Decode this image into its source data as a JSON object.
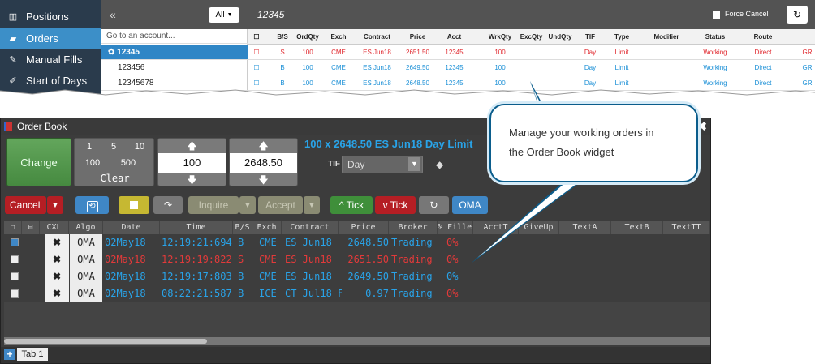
{
  "nav": {
    "items": [
      {
        "label": "Positions",
        "icon": "chart-icon"
      },
      {
        "label": "Orders",
        "icon": "book-icon"
      },
      {
        "label": "Manual Fills",
        "icon": "hammer-icon"
      },
      {
        "label": "Start of Days",
        "icon": "pin-icon"
      }
    ]
  },
  "account_panel": {
    "collapse_glyph": "«",
    "all_label": "All",
    "search_placeholder": "Go to an account...",
    "accounts": [
      "12345",
      "123456",
      "12345678"
    ]
  },
  "grid": {
    "title": "12345",
    "force_cancel_label": "Force Cancel",
    "columns": [
      "B/S",
      "OrdQty",
      "Exch",
      "Contract",
      "Price",
      "Acct",
      "WrkQty",
      "ExcQty",
      "UndQty",
      "TIF",
      "Type",
      "Modifier",
      "Status",
      "Route"
    ],
    "rows": [
      {
        "bs": "S",
        "ordqty": "100",
        "exch": "CME",
        "contract": "ES Jun18",
        "price": "2651.50",
        "acct": "12345",
        "wrkqty": "100",
        "tif": "Day",
        "type": "Limit",
        "status": "Working",
        "route": "Direct",
        "extra": "GR",
        "color": "red"
      },
      {
        "bs": "B",
        "ordqty": "100",
        "exch": "CME",
        "contract": "ES Jun18",
        "price": "2649.50",
        "acct": "12345",
        "wrkqty": "100",
        "tif": "Day",
        "type": "Limit",
        "status": "Working",
        "route": "Direct",
        "extra": "GR",
        "color": "blue"
      },
      {
        "bs": "B",
        "ordqty": "100",
        "exch": "CME",
        "contract": "ES Jun18",
        "price": "2648.50",
        "acct": "12345",
        "wrkqty": "100",
        "tif": "Day",
        "type": "Limit",
        "status": "Working",
        "route": "Direct",
        "extra": "GR",
        "color": "blue"
      }
    ]
  },
  "callout": {
    "line1": "Manage your working orders in",
    "line2": "the Order Book widget"
  },
  "order_book": {
    "title": "Order Book",
    "change_label": "Change",
    "qty_keys": [
      "1",
      "5",
      "10",
      "100",
      "500"
    ],
    "clear_label": "Clear",
    "quantity_value": "100",
    "price_value": "2648.50",
    "order_summary": "100 x 2648.50 ES Jun18 Day Limit",
    "tif_label": "TIF",
    "tif_value": "Day",
    "buttons": {
      "cancel": "Cancel",
      "inquire": "Inquire",
      "accept": "Accept",
      "buy_tick": "Tick",
      "sell_tick": "Tick",
      "oma": "OMA"
    },
    "columns": [
      "CXL",
      "Algo",
      "Date",
      "Time",
      "B/S",
      "Exch",
      "Contract",
      "Price",
      "Broker",
      "% Filled",
      "AcctT",
      "GiveUp",
      "TextA",
      "TextB",
      "TextTT"
    ],
    "rows": [
      {
        "checked": true,
        "cxl": "✖",
        "algo": "OMA",
        "date": "02May18",
        "time": "12:19:21:694",
        "bs": "B",
        "exch": "CME",
        "contract": "ES Jun18",
        "price": "2648.50",
        "broker": "Trading",
        "filled": "0%",
        "color": "blue"
      },
      {
        "checked": false,
        "cxl": "✖",
        "algo": "OMA",
        "date": "02May18",
        "time": "12:19:19:822",
        "bs": "S",
        "exch": "CME",
        "contract": "ES Jun18",
        "price": "2651.50",
        "broker": "Trading",
        "filled": "0%",
        "color": "red"
      },
      {
        "checked": false,
        "cxl": "✖",
        "algo": "OMA",
        "date": "02May18",
        "time": "12:19:17:803",
        "bs": "B",
        "exch": "CME",
        "contract": "ES Jun18",
        "price": "2649.50",
        "broker": "Trading",
        "filled": "0%",
        "color": "blue"
      },
      {
        "checked": false,
        "cxl": "✖",
        "algo": "OMA",
        "date": "02May18",
        "time": "08:22:21:587",
        "bs": "B",
        "exch": "ICE",
        "contract": "CT Jul18 F",
        "price": "0.97",
        "broker": "Trading",
        "filled": "0%",
        "color": "blue"
      }
    ],
    "tab_label": "Tab 1"
  },
  "colors": {
    "buy": "#29a3e8",
    "sell": "#e23a3a",
    "accent": "#3f87c6",
    "nav_bg": "#2a3b4c"
  }
}
